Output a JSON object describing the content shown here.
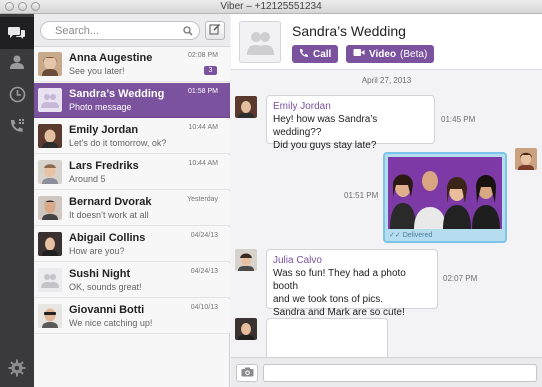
{
  "window": {
    "title": "Viber – +12125551234"
  },
  "search": {
    "placeholder": "Search..."
  },
  "conversations": [
    {
      "name": "Anna Augestine",
      "preview": "See you later!",
      "time": "02:08 PM",
      "badge": "3"
    },
    {
      "name": "Sandra’s Wedding",
      "preview": "Photo message",
      "time": "01:58 PM",
      "badge": ""
    },
    {
      "name": "Emily Jordan",
      "preview": "Let’s do it tomorrow, ok?",
      "time": "10:44 AM",
      "badge": ""
    },
    {
      "name": "Lars Fredriks",
      "preview": "Around 5",
      "time": "10:44 AM",
      "badge": ""
    },
    {
      "name": "Bernard Dvorak",
      "preview": "It doesn’t work at all",
      "time": "Yesterday",
      "badge": ""
    },
    {
      "name": "Abigail Collins",
      "preview": "How are you?",
      "time": "04/24/13",
      "badge": ""
    },
    {
      "name": "Sushi Night",
      "preview": "OK, sounds great!",
      "time": "04/24/13",
      "badge": ""
    },
    {
      "name": "Giovanni Botti",
      "preview": "We nice catching up!",
      "time": "04/10/13",
      "badge": ""
    }
  ],
  "chat": {
    "title": "Sandra’s Wedding",
    "call_label": "Call",
    "video_label": "Video",
    "video_suffix": "(Beta)",
    "date": "April 27, 2013",
    "messages": [
      {
        "sender": "Emily Jordan",
        "lines": [
          "Hey! how was Sandra’s wedding??",
          "Did you guys stay late?"
        ],
        "time": "01:45 PM"
      },
      {
        "sender": "",
        "lines": [],
        "time": "01:51 PM",
        "status": "Delivered"
      },
      {
        "sender": "Julia Calvo",
        "lines": [
          "Was so fun! They had a photo booth",
          "and we took tons of pics.",
          "Sandra and Mark are so cute!"
        ],
        "time": "02:07 PM"
      }
    ],
    "input_placeholder": ""
  },
  "colors": {
    "accent": "#7b529e",
    "rail": "#3a3a3c",
    "photo_border": "#7cc4e8"
  },
  "icons": {
    "rail": [
      "chat-bubbles-icon",
      "contacts-icon",
      "recents-clock-icon",
      "keypad-icon",
      "settings-gear-icon"
    ]
  }
}
